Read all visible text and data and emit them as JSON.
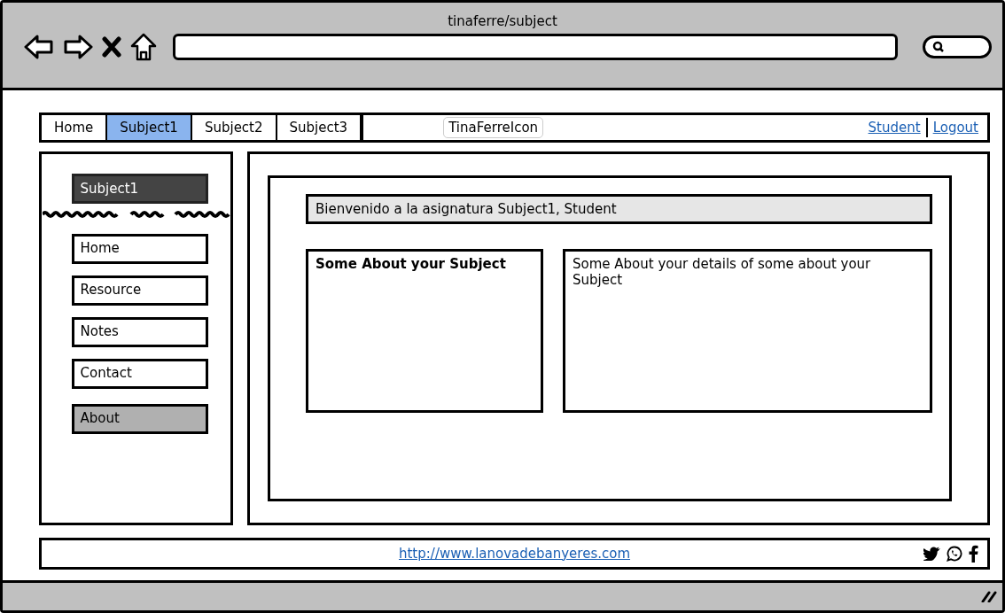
{
  "window": {
    "title": "tinaferre/subject"
  },
  "nav": {
    "tabs": [
      {
        "label": "Home",
        "selected": false
      },
      {
        "label": "Subject1",
        "selected": true
      },
      {
        "label": "Subject2",
        "selected": false
      },
      {
        "label": "Subject3",
        "selected": false
      }
    ],
    "logo": "TinaFerreIcon",
    "links": [
      "Student",
      "Logout"
    ]
  },
  "sidebar": {
    "heading": "Subject1",
    "items": [
      {
        "label": "Home",
        "selected": false
      },
      {
        "label": "Resource",
        "selected": false
      },
      {
        "label": "Notes",
        "selected": false
      },
      {
        "label": "Contact",
        "selected": false
      },
      {
        "label": "About",
        "selected": true
      }
    ]
  },
  "main": {
    "welcome": "Bienvenido a la asignatura Subject1, Student",
    "about_title": "Some About your Subject",
    "details": "Some About your details of some about your Subject"
  },
  "footer": {
    "link": "http://www.lanovadebanyeres.com"
  }
}
